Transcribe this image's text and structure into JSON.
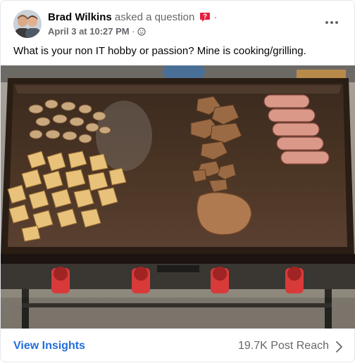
{
  "post": {
    "author": "Brad Wilkins",
    "action": "asked a question",
    "separator": "·",
    "date": "April 3 at 10:27 PM",
    "dot": "·",
    "text": "What is your non IT hobby or passion? Mine is cooking/grilling.",
    "question_icon": "question-mark-badge-icon",
    "audience_icon": "globe-icon",
    "photo_description_icon": "griddle-photo"
  },
  "footer": {
    "insights_label": "View Insights",
    "reach_label": "19.7K Post Reach"
  },
  "colors": {
    "link": "#216fdb",
    "secondary_text": "#65676b",
    "question_badge": "#e41e3f"
  }
}
